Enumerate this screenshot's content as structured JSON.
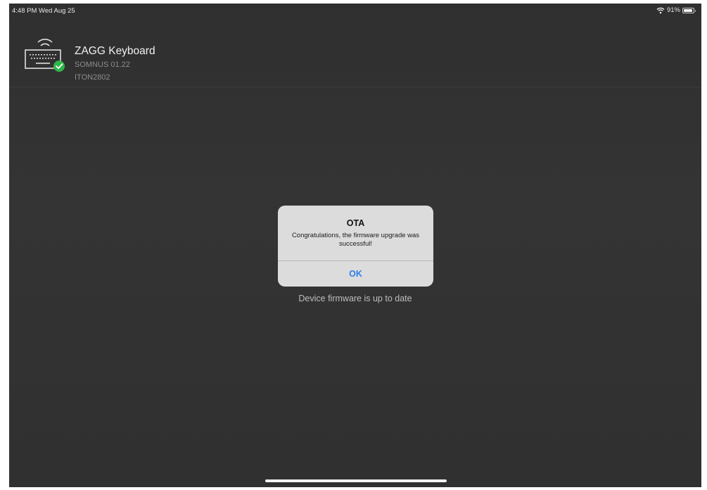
{
  "status_bar": {
    "time_date": "4:48 PM  Wed Aug 25",
    "battery_percent": "91%",
    "battery_level": 0.91,
    "icons": [
      "wifi-icon",
      "battery-icon"
    ]
  },
  "device": {
    "name": "ZAGG Keyboard",
    "firmware": "SOMNUS 01.22",
    "id": "ITON2802",
    "icon": "keyboard-icon",
    "connected_badge_color": "#2fb54a"
  },
  "main": {
    "firmware_status": "Device firmware is up to date"
  },
  "alert": {
    "title": "OTA",
    "message": "Congratulations, the firmware upgrade was successful!",
    "ok_label": "OK",
    "ok_color": "#2d7fe8"
  }
}
